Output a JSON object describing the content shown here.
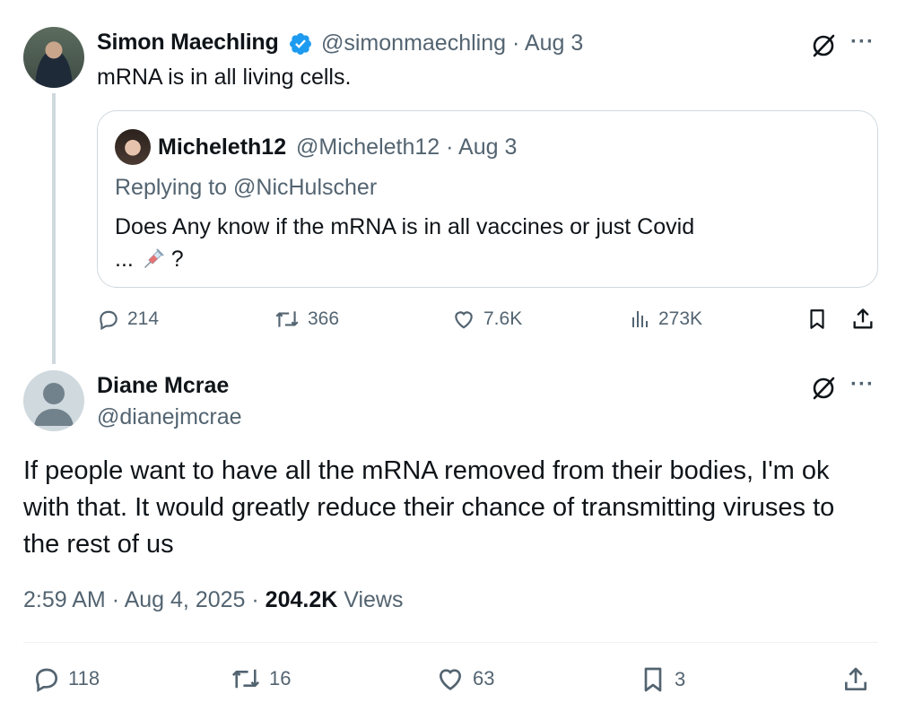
{
  "parent_tweet": {
    "author_name": "Simon Maechling",
    "handle": "@simonmaechling",
    "date": "Aug 3",
    "text": "mRNA is in all living cells.",
    "quoted": {
      "author_name": "Micheleth12",
      "handle": "@Micheleth12",
      "date": "Aug 3",
      "replying_to": "Replying to @NicHulscher",
      "text_line1": "Does Any know if the mRNA is in all vaccines or just Covid",
      "text_line2_prefix": "...",
      "text_line2_suffix": "?"
    },
    "stats": {
      "replies": "214",
      "reposts": "366",
      "likes": "7.6K",
      "views": "273K"
    }
  },
  "main_tweet": {
    "author_name": "Diane Mcrae",
    "handle": "@dianejmcrae",
    "text": "If people want to have all the mRNA removed from their bodies, I'm ok with that. It would greatly reduce their chance of transmitting viruses to the rest of us",
    "time": "2:59 AM",
    "date": "Aug 4, 2025",
    "views_count": "204.2K",
    "views_label": "Views",
    "stats": {
      "replies": "118",
      "reposts": "16",
      "likes": "63",
      "bookmarks": "3"
    }
  },
  "colors": {
    "text": "#0f1419",
    "secondary": "#536471",
    "verified": "#1d9bf0",
    "border": "#cfd9de"
  },
  "icons": [
    "verified-badge-icon",
    "grok-icon",
    "more-icon",
    "reply-icon",
    "repost-icon",
    "like-icon",
    "views-icon",
    "bookmark-icon",
    "share-icon",
    "syringe-icon"
  ]
}
